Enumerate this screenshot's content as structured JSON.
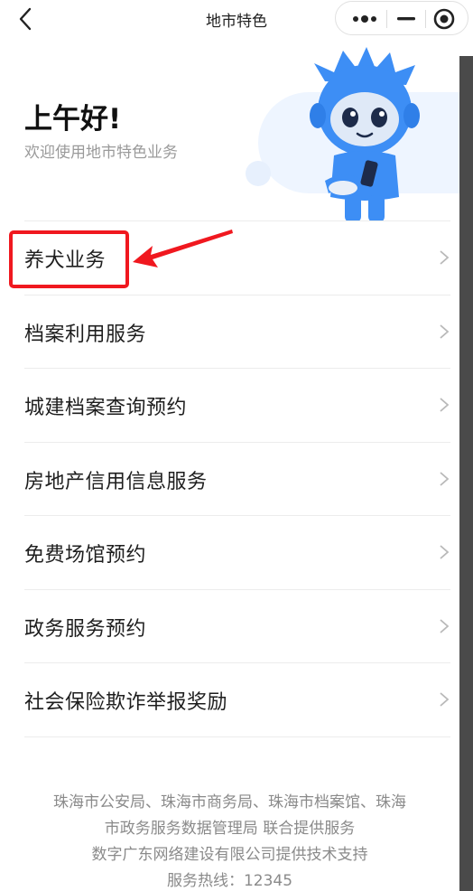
{
  "navbar": {
    "title": "地市特色"
  },
  "header": {
    "greeting": "上午好!",
    "welcome": "欢迎使用地市特色业务"
  },
  "menu": {
    "items": [
      {
        "label": "养犬业务"
      },
      {
        "label": "档案利用服务"
      },
      {
        "label": "城建档案查询预约"
      },
      {
        "label": "房地产信用信息服务"
      },
      {
        "label": "免费场馆预约"
      },
      {
        "label": "政务服务预约"
      },
      {
        "label": "社会保险欺诈举报奖励"
      }
    ]
  },
  "footer": {
    "line1": "珠海市公安局、珠海市商务局、珠海市档案馆、珠海",
    "line2": "市政务服务数据管理局 联合提供服务",
    "line3": "数字广东网络建设有限公司提供技术支持",
    "line4": "服务热线：12345"
  },
  "colors": {
    "accent_blue": "#3d8ef5",
    "highlight_red": "#f0181f",
    "text_secondary": "#9a9a9a"
  },
  "icons": {
    "back": "chevron-left-icon",
    "more": "more-dots-icon",
    "minimize": "minus-icon",
    "close": "target-circle-icon",
    "item_arrow": "chevron-right-icon"
  }
}
